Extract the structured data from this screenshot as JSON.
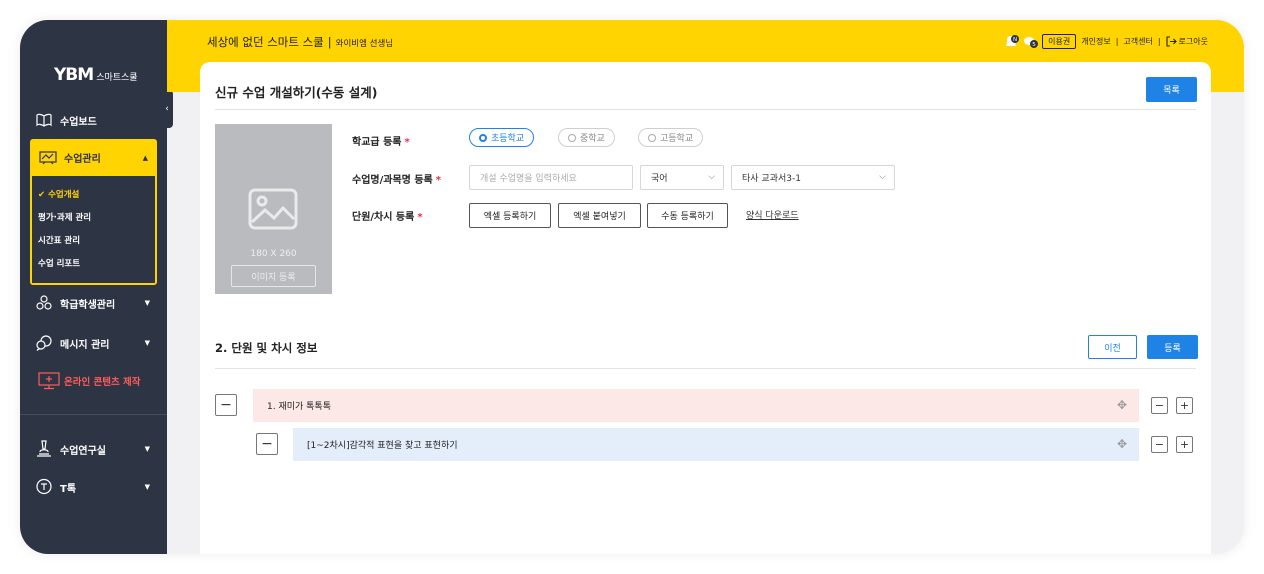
{
  "sidebar": {
    "logo_mark": "YBM",
    "logo_text": "스마트스쿨",
    "items": {
      "dashboard": "수업보드",
      "class_manage": "수업관리",
      "student_manage": "학급학생관리",
      "message": "메시지 관리",
      "online": "온라인 콘텐츠 제작",
      "research": "수업연구실",
      "t_talk": "T톡"
    },
    "submenu": [
      "✔ 수업개설",
      "평가·과제 관리",
      "시간표 관리",
      "수업 리포트"
    ]
  },
  "topbar": {
    "school": "세상에 없던 스마트 스쿨",
    "separator": "|",
    "teacher": "와이비엠 선생님",
    "usage": "이용권",
    "privacy": "개인정보",
    "support": "고객센터",
    "logout": "로그아웃",
    "sep": "|",
    "bell_badge": "N",
    "msg_badge": "5"
  },
  "page": {
    "title": "신규 수업 개설하기(수동 설계)",
    "list_button": "목록",
    "image": {
      "size": "180 X 260",
      "register": "이미지 등록"
    },
    "school_level": {
      "label": "학교급 등록",
      "options": [
        "초등학교",
        "중학교",
        "고등학교"
      ],
      "selected": "초등학교"
    },
    "subject": {
      "label": "수업명/과목명 등록",
      "placeholder": "개설 수업명을 입력하세요",
      "subject_select": "국어",
      "textbook_select": "타사 교과서3-1"
    },
    "unit": {
      "label": "단원/차시 등록",
      "excel_register": "엑셀 등록하기",
      "excel_paste": "엑셀 붙여넣기",
      "manual_register": "수동 등록하기",
      "form_download": "양식 다운로드"
    },
    "required_mark": "*",
    "section2": {
      "title": "2. 단원 및 차시 정보",
      "prev": "이전",
      "register": "등록",
      "unit_row": "1. 재미가 톡톡톡",
      "lesson_row": "[1~2차시]감각적 표현을 찾고 표현하기"
    }
  },
  "colors": {
    "accent_yellow": "#ffd400",
    "sidebar_bg": "#2d3443",
    "primary_blue": "#1f82e5",
    "unit_row_bg": "#fde8e8",
    "lesson_row_bg": "#e3eefa"
  }
}
